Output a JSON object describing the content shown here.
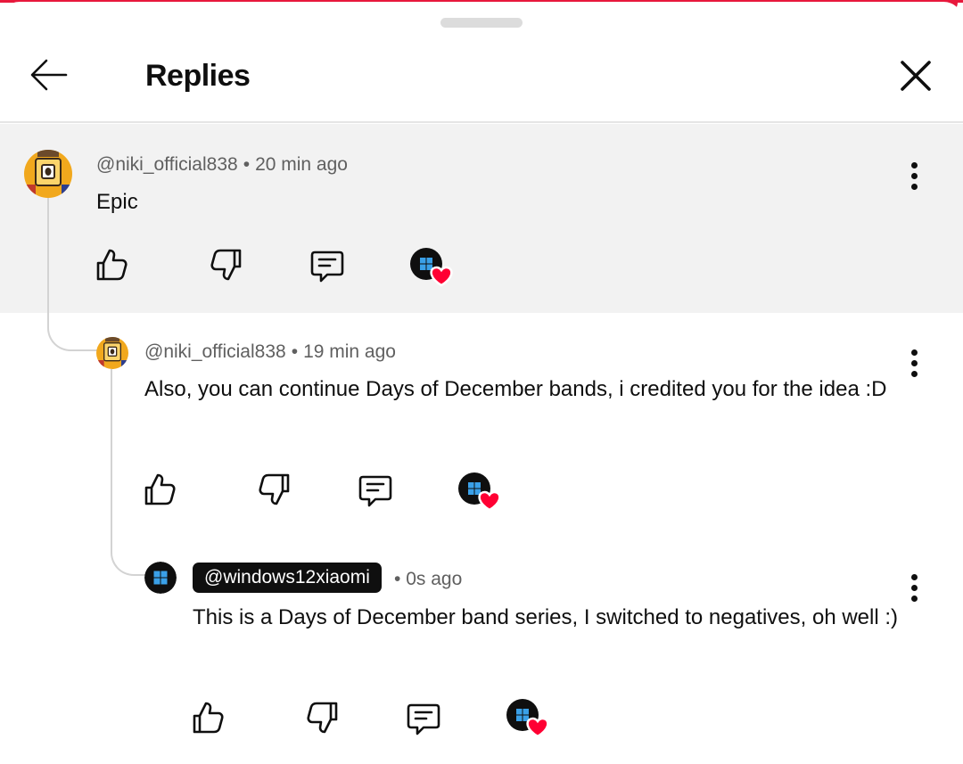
{
  "header": {
    "title": "Replies",
    "back_icon": "arrow-left-icon",
    "close_icon": "close-icon"
  },
  "colors": {
    "accent": "#e8183c",
    "highlight_bg": "#f2f2f2",
    "chip_bg": "#0f0f0f",
    "heart": "#ff0033",
    "thread_line": "#d3d3d3"
  },
  "comments": [
    {
      "author": "@niki_official838",
      "time": "20 min ago",
      "text": "Epic",
      "highlighted": true
    },
    {
      "author": "@niki_official838",
      "time": "19 min ago",
      "text": "Also, you can continue Days of December bands, i credited you for the idea :D"
    },
    {
      "author": "@windows12xiaomi",
      "time": "0s ago",
      "text": "This is a Days of December band series, I switched to negatives, oh well :)",
      "is_owner": true
    }
  ],
  "actions": {
    "like_icon": "thumbs-up-icon",
    "dislike_icon": "thumbs-down-icon",
    "reply_icon": "reply-icon",
    "creator_heart_icon": "creator-heart-icon",
    "more_icon": "more-vertical-icon"
  }
}
